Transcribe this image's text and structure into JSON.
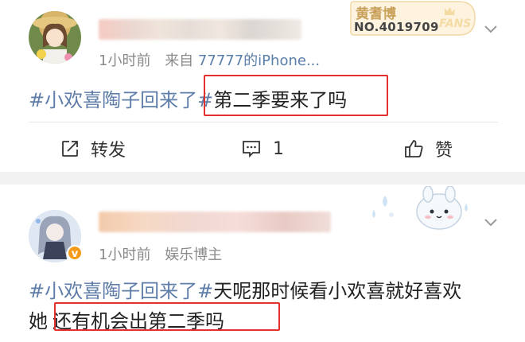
{
  "post1": {
    "time": "1小时前",
    "source_prefix": "来自",
    "source": "77777的iPhone...",
    "hashtag": "#小欢喜陶子回来了#",
    "text": "第二季要来了吗",
    "badge": {
      "title": "黄耆博",
      "number": "NO.4019709",
      "fans": "FANS"
    },
    "actions": {
      "repost": "转发",
      "comment": "1",
      "like": "赞"
    }
  },
  "post2": {
    "time": "1小时前",
    "category": "娱乐博主",
    "hashtag": "#小欢喜陶子回来了#",
    "text_line1": "天呢那时候看小欢喜就好喜欢",
    "text_line2_prefix": "她",
    "text_line2_highlight": "还有机会出第二季吗",
    "verified_badge": "v"
  },
  "colors": {
    "hashtag": "#5e7da8",
    "highlight_box": "#e3312e",
    "divider": "#f2f2f2",
    "badge_gold": "#c8a05a"
  },
  "icons": [
    "chevron-down-icon",
    "repost-icon",
    "comment-icon",
    "like-icon",
    "verified-icon",
    "rabbit-decoration-icon"
  ]
}
